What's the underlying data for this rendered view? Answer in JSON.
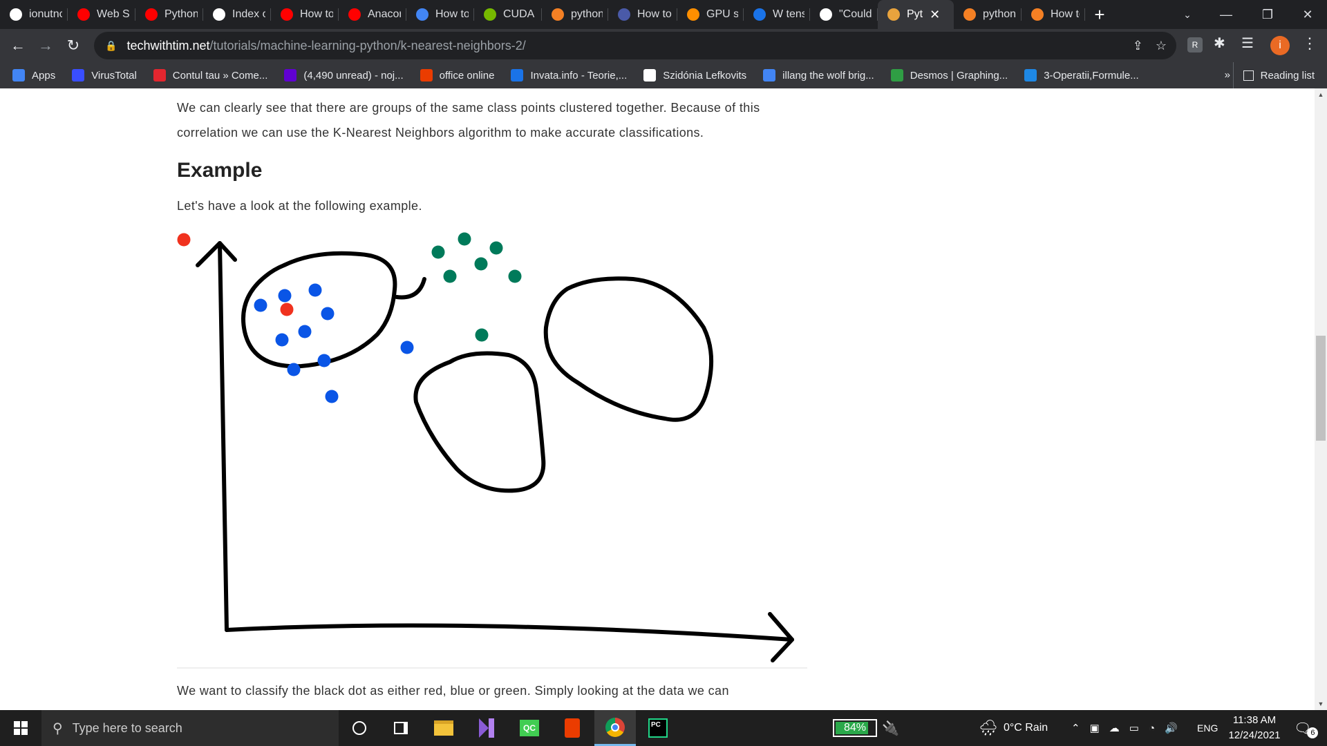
{
  "browser": {
    "tabs": [
      {
        "title": "ionutnc",
        "favicon": "github-icon",
        "color": "#ffffff"
      },
      {
        "title": "Web Sc",
        "favicon": "youtube-icon",
        "color": "#ff0000"
      },
      {
        "title": "Python",
        "favicon": "youtube-icon",
        "color": "#ff0000"
      },
      {
        "title": "Index o",
        "favicon": "globe-icon",
        "color": "#ffffff"
      },
      {
        "title": "How to",
        "favicon": "youtube-icon",
        "color": "#ff0000"
      },
      {
        "title": "Anacon",
        "favicon": "youtube-icon",
        "color": "#ff0000"
      },
      {
        "title": "How to",
        "favicon": "dots-icon",
        "color": "#4285f4"
      },
      {
        "title": "CUDA T",
        "favicon": "nvidia-icon",
        "color": "#76b900"
      },
      {
        "title": "python",
        "favicon": "stackoverflow-icon",
        "color": "#f48024"
      },
      {
        "title": "How to",
        "favicon": "tds-icon",
        "color": "#4a5aa8"
      },
      {
        "title": "GPU su",
        "favicon": "tensorflow-icon",
        "color": "#ff8f00"
      },
      {
        "title": "W tens",
        "favicon": "circle-icon",
        "color": "#1a73e8"
      },
      {
        "title": "\"Could",
        "favicon": "github-icon",
        "color": "#ffffff"
      },
      {
        "title": "Pyt",
        "favicon": "techwithtim-icon",
        "color": "#e8a33d",
        "active": true
      },
      {
        "title": "python",
        "favicon": "stackoverflow-icon",
        "color": "#f48024"
      },
      {
        "title": "How to",
        "favicon": "stackoverflow-icon",
        "color": "#f48024"
      }
    ],
    "url_host": "techwithtim.net",
    "url_path": "/tutorials/machine-learning-python/k-nearest-neighbors-2/",
    "profile_initial": "i",
    "bookmarks": [
      {
        "label": "Apps",
        "icon": "apps-grid-icon",
        "color": "#4285f4"
      },
      {
        "label": "VirusTotal",
        "icon": "virustotal-icon",
        "color": "#394eff"
      },
      {
        "label": "Contul tau » Come...",
        "icon": "emag-icon",
        "color": "#e3262f"
      },
      {
        "label": "(4,490 unread) - noj...",
        "icon": "yahoo-mail-icon",
        "color": "#6001d2"
      },
      {
        "label": "office online",
        "icon": "office-icon",
        "color": "#eb3c00"
      },
      {
        "label": "Invata.info - Teorie,...",
        "icon": "invata-icon",
        "color": "#1a73e8"
      },
      {
        "label": "Szidónia Lefkovits",
        "icon": "globe-icon",
        "color": "#ffffff"
      },
      {
        "label": "illang the wolf brig...",
        "icon": "google-icon",
        "color": "#4285f4"
      },
      {
        "label": "Desmos | Graphing...",
        "icon": "desmos-icon",
        "color": "#2f9e44"
      },
      {
        "label": "3-Operatii,Formule...",
        "icon": "s-icon",
        "color": "#1e88e5"
      }
    ],
    "bookmarks_more": "»",
    "reading_list": "Reading list"
  },
  "article": {
    "p1": "We can clearly see that there are groups of the same class points clustered together. Because of this correlation we can use the K-Nearest Neighbors algorithm to make accurate classifications.",
    "heading": "Example",
    "p2": "Let's have a look at the following example.",
    "p3": "We want to classify the black dot as either red, blue or green. Simply looking at the data we can",
    "colors": {
      "red": "#f0321e",
      "blue": "#0a55e6",
      "green": "#007a5a",
      "black": "#000000"
    }
  },
  "taskbar": {
    "search_placeholder": "Type here to search",
    "apps": [
      "cortana-icon",
      "task-view-icon",
      "file-explorer-icon",
      "visual-studio-icon",
      "qt-creator-icon",
      "office-icon",
      "chrome-icon",
      "pycharm-icon"
    ],
    "battery": "84%",
    "battery_level": 0.84,
    "weather": "0°C Rain",
    "language": "ENG",
    "time": "11:38 AM",
    "date": "12/24/2021",
    "notifications": "6"
  }
}
